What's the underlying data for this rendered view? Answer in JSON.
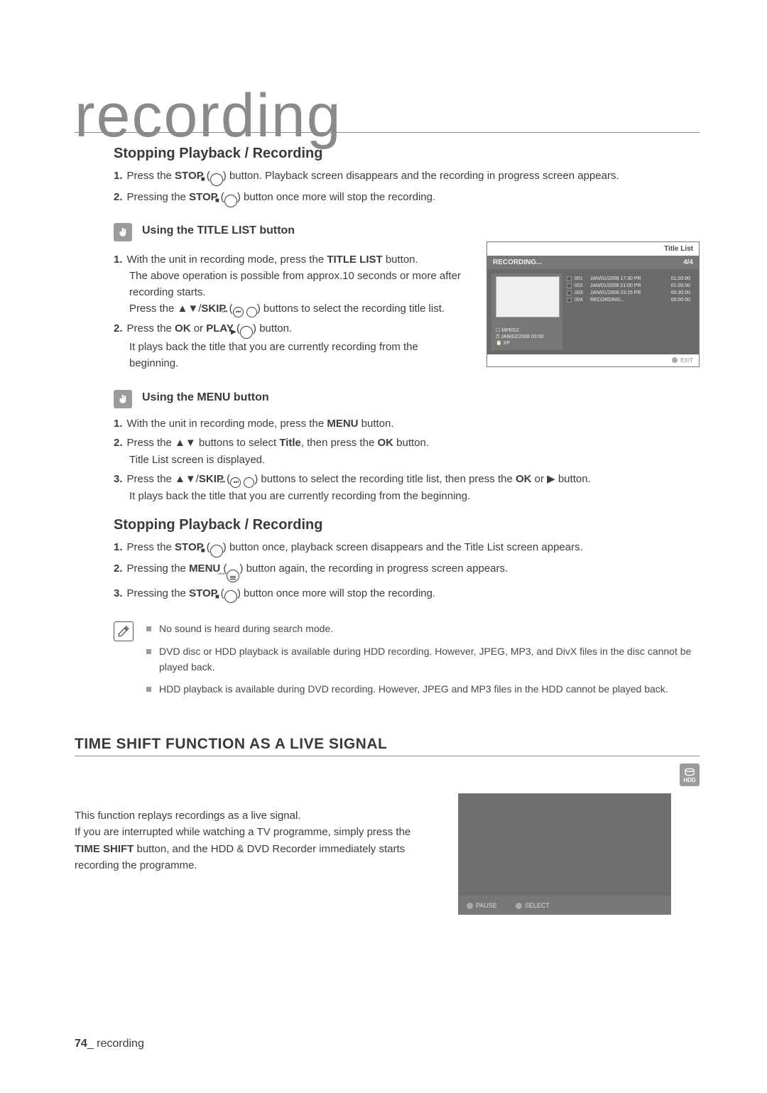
{
  "title": "recording",
  "section1": {
    "heading": "Stopping Playback / Recording",
    "items": [
      {
        "n": "1.",
        "pre": "Press the ",
        "b": "STOP",
        "after_icon": " button. Playback screen disappears and the recording in progress screen appears."
      },
      {
        "n": "2.",
        "pre": "Pressing the ",
        "b": "STOP",
        "after_icon": " button once more will stop the recording."
      }
    ]
  },
  "hint1": {
    "label": "Using the TITLE LIST button",
    "items": [
      {
        "n": "1.",
        "line1_pre": "With the unit in recording mode, press the ",
        "line1_b": "TITLE LIST",
        "line1_post": " button.",
        "line2": "The above operation is possible from approx.10 seconds or more after recording starts.",
        "line3_pre": "Press the ▲▼/",
        "line3_b": "SKIP",
        "line3_post": " buttons to select the recording title list."
      },
      {
        "n": "2.",
        "line1_pre": "Press the ",
        "line1_b1": "OK",
        "line1_mid": " or ",
        "line1_b2": "PLAY",
        "line1_post": " button.",
        "line2": "It plays back the title that you are currently recording from the beginning."
      }
    ]
  },
  "shot1": {
    "head_left": "RECORDING...",
    "head_right_label": "Title List",
    "head_right_count": "4/4",
    "rows": [
      {
        "idx": "001",
        "name": "JAN/01/2008 17:30 PR",
        "dur": "01:00:00"
      },
      {
        "idx": "002",
        "name": "JAN/01/2008 21:00 PR",
        "dur": "01:00:00"
      },
      {
        "idx": "003",
        "name": "JAN/01/2008 23:15 PR",
        "dur": "00:30:00"
      },
      {
        "idx": "004",
        "name": "RECORDING...",
        "dur": "00:00:00"
      }
    ],
    "meta1": "☐ MPEG2",
    "meta2": "⏱ JAN/02/2008 00:00",
    "meta3": "📋 XP",
    "foot": "EXIT"
  },
  "hint2": {
    "label": "Using the MENU button",
    "items": [
      {
        "n": "1.",
        "pre": "With the unit in recording mode, press the ",
        "b": "MENU",
        "post": " button."
      },
      {
        "n": "2.",
        "pre": "Press the ▲▼ buttons to select ",
        "b1": "Title",
        "mid": ", then press the ",
        "b2": "OK",
        "post": " button.",
        "l2": "Title List screen is displayed."
      },
      {
        "n": "3.",
        "pre": "Press the ▲▼/",
        "b": "SKIP",
        "post_icons": " buttons to select the recording title list, then press the ",
        "b2": "OK",
        "mid2": " or ▶ button.",
        "l2": "It plays back the title that you are currently recording from the beginning."
      }
    ]
  },
  "section2": {
    "heading": "Stopping Playback / Recording",
    "items": [
      {
        "n": "1.",
        "pre": "Press the ",
        "b": "STOP",
        "post": " button once, playback screen disappears and the Title List screen appears."
      },
      {
        "n": "2.",
        "pre": "Pressing the ",
        "b": "MENU",
        "post": " button again, the recording in progress screen appears."
      },
      {
        "n": "3.",
        "pre": "Pressing the ",
        "b": "STOP",
        "post": " button once more will stop the recording."
      }
    ]
  },
  "notes": [
    "No sound is heard during search mode.",
    "DVD disc or HDD playback is available during HDD recording. However, JPEG, MP3, and DivX files in the disc cannot be played back.",
    "HDD playback is available during DVD recording. However, JPEG and MP3 files in the HDD cannot be played back."
  ],
  "time_shift": {
    "heading": "TIME SHIFT FUNCTION AS A LIVE SIGNAL",
    "hdd_label": "HDD",
    "p1": "This function replays recordings as a live signal.",
    "p2_pre": "If you are interrupted while watching a TV programme, simply press the ",
    "p2_b": "TIME SHIFT",
    "p2_post": " button, and the HDD & DVD Recorder immediately starts recording the programme."
  },
  "shot2": {
    "buttons": [
      "PAUSE",
      "SELECT"
    ]
  },
  "footer": {
    "page": "74",
    "section": "_ recording"
  }
}
